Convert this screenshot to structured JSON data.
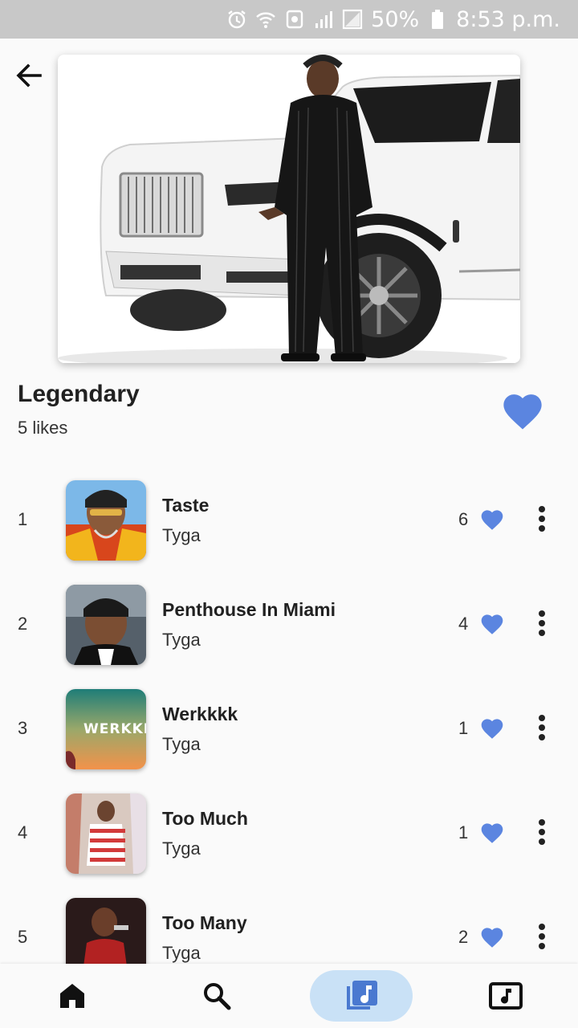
{
  "status_bar": {
    "battery": "50%",
    "time": "8:53 p.m.",
    "icons": [
      "alarm-icon",
      "wifi-icon",
      "data-saver-icon",
      "signal-icon",
      "signal-icon",
      "battery-icon"
    ]
  },
  "header": {
    "back_icon": "arrow-left-icon"
  },
  "playlist": {
    "title": "Legendary",
    "likes": "5 likes",
    "liked": true
  },
  "accent_color": "#5b85e0",
  "tracks": [
    {
      "number": "1",
      "title": "Taste",
      "artist": "Tyga",
      "likes": "6"
    },
    {
      "number": "2",
      "title": "Penthouse In Miami",
      "artist": "Tyga",
      "likes": "4"
    },
    {
      "number": "3",
      "title": "Werkkkk",
      "artist": "Tyga",
      "likes": "1",
      "art_text": "WERKKK"
    },
    {
      "number": "4",
      "title": "Too Much",
      "artist": "Tyga",
      "likes": "1"
    },
    {
      "number": "5",
      "title": "Too Many",
      "artist": "Tyga",
      "likes": "2"
    }
  ],
  "nav": {
    "items": [
      "home-icon",
      "search-icon",
      "library-music-icon",
      "music-video-icon"
    ],
    "active": "library-music-icon"
  }
}
